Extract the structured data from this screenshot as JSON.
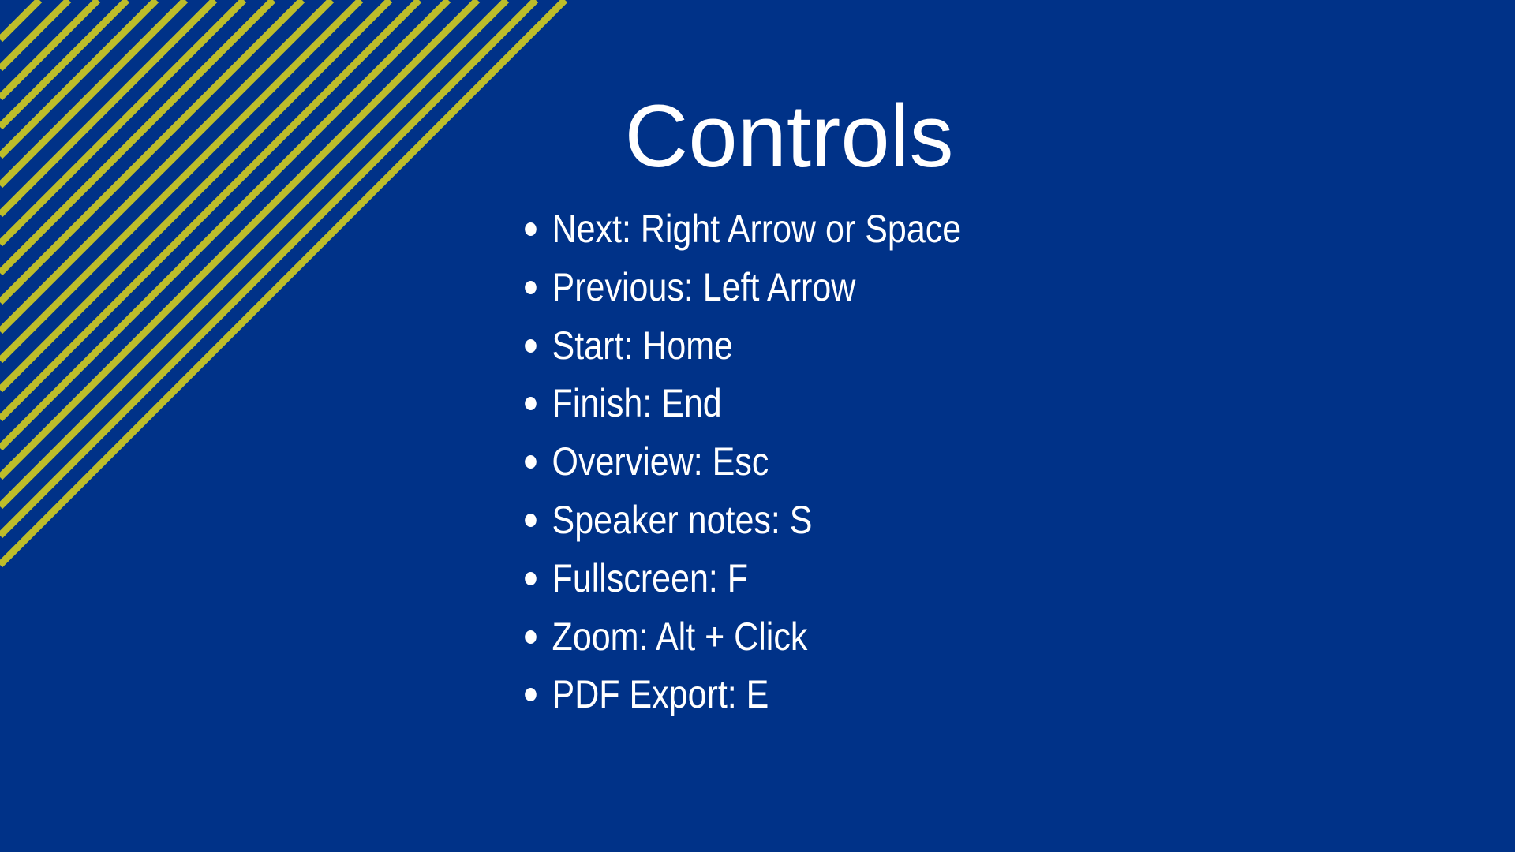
{
  "slide": {
    "title": "Controls",
    "background_color": "#003288",
    "stripe_color": "#BDBD2A",
    "items": [
      "Next: Right Arrow or Space",
      "Previous: Left Arrow",
      "Start: Home",
      "Finish: End",
      "Overview: Esc",
      "Speaker notes: S",
      "Fullscreen: F",
      "Zoom: Alt + Click",
      "PDF Export: E"
    ]
  }
}
